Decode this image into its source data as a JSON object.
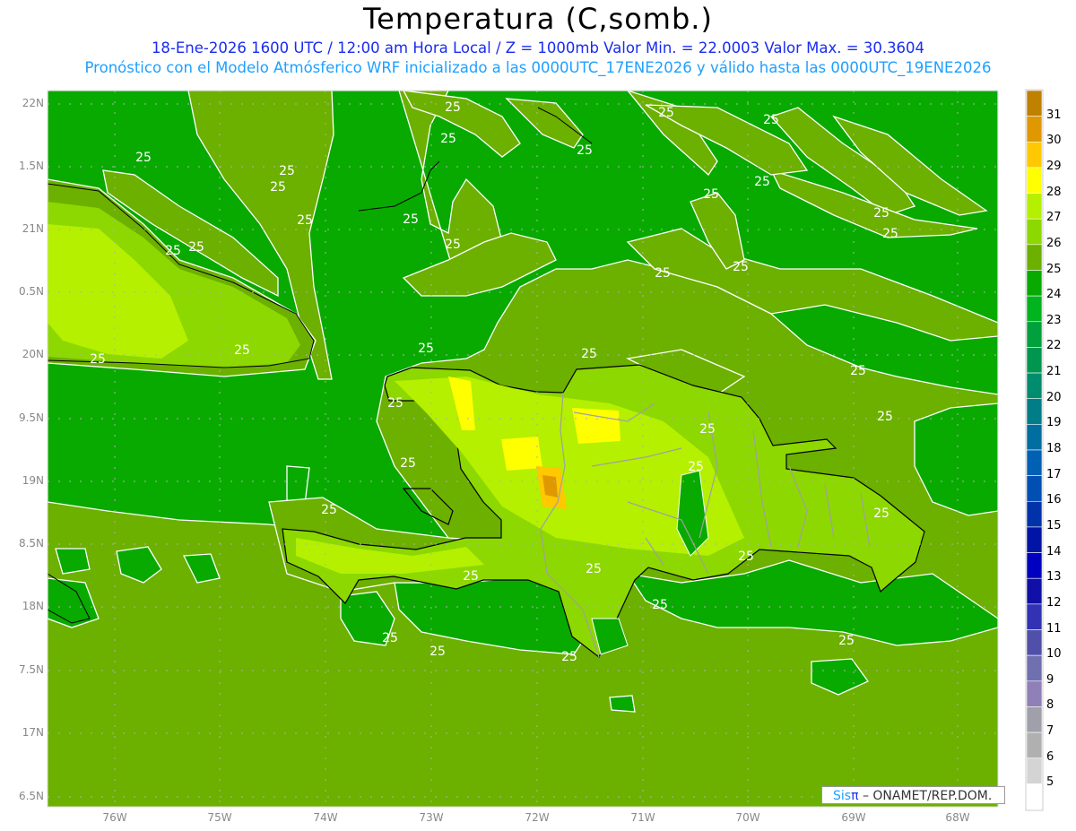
{
  "header": {
    "title": "Temperatura (C,somb.)",
    "subtitle_line1": "18-Ene-2026 1600 UTC / 12:00 am Hora Local / Z = 1000mb   Valor Min. = 22.0003   Valor Max. = 30.3604",
    "subtitle_line2": "Pronóstico con el Modelo Atmósferico WRF inicializado a las 0000UTC_17ENE2026 y válido hasta las  0000UTC_19ENE2026"
  },
  "map": {
    "latitude_labels": [
      "22N",
      "1.5N",
      "21N",
      "0.5N",
      "20N",
      "9.5N",
      "19N",
      "8.5N",
      "18N",
      "7.5N",
      "17N",
      "6.5N"
    ],
    "longitude_labels": [
      "76W",
      "75W",
      "74W",
      "73W",
      "72W",
      "71W",
      "70W",
      "69W",
      "68W"
    ],
    "contour_label": "25",
    "colors": {
      "c24_25": "#08aa00",
      "c25_26": "#6cb000",
      "c26_27": "#8cd800",
      "c27_28": "#b4f000",
      "c28_29": "#ffff00",
      "c29_30": "#ffc800",
      "c30_31": "#e09800",
      "contour": "#ffffff",
      "coast": "#000000",
      "border": "#a0a0a0",
      "grid": "#b0b0b0"
    }
  },
  "colorbar": {
    "labels": [
      "31",
      "30",
      "29",
      "28",
      "27",
      "26",
      "25",
      "24",
      "23",
      "22",
      "21",
      "20",
      "19",
      "18",
      "17",
      "16",
      "15",
      "14",
      "13",
      "12",
      "11",
      "10",
      "9",
      "8",
      "7",
      "6",
      "5"
    ],
    "colors": [
      "#c08000",
      "#e09800",
      "#ffc800",
      "#ffff00",
      "#b4f000",
      "#8cd800",
      "#6cb000",
      "#08aa00",
      "#00b41e",
      "#00a03c",
      "#009650",
      "#008c6e",
      "#007d87",
      "#006ea0",
      "#0060b4",
      "#0050b4",
      "#0032aa",
      "#0014a5",
      "#0000c0",
      "#1010a8",
      "#3232b4",
      "#5050aa",
      "#7070b0",
      "#9080b8",
      "#a0a0aa",
      "#b0b0b0",
      "#d4d4d4",
      "#ffffff"
    ]
  },
  "credit": {
    "brand_sis": "Sis",
    "brand_pi": "π",
    "text": " – ONAMET/REP.DOM."
  }
}
